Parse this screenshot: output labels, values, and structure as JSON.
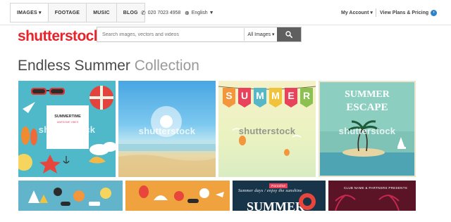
{
  "nav": {
    "tabs": [
      {
        "label": "IMAGES ▾"
      },
      {
        "label": "FOOTAGE"
      },
      {
        "label": "MUSIC"
      },
      {
        "label": "BLOG"
      }
    ],
    "phone": "020 7023 4958",
    "language": "English ▼",
    "account": "My Account ▾",
    "plans": "View Plans & Pricing"
  },
  "brand": {
    "logo": "shutterstock"
  },
  "search": {
    "placeholder": "Search images, vectors and videos",
    "type": "All Images ▾"
  },
  "collection": {
    "title_main": "Endless Summer",
    "title_sub": "Collection"
  },
  "tiles": {
    "watermark": "shutterstock",
    "t1": {
      "card_title": "SUMMERTIME",
      "card_sub": "AWESOME VIBES"
    },
    "t3": {
      "letters": [
        "S",
        "U",
        "M",
        "M",
        "E",
        "R"
      ]
    },
    "t4": {
      "line1": "SUMMER",
      "line2": "ESCAPE"
    },
    "t7": {
      "badge": "Paradise",
      "script": "Summer days / enjoy the sunshine",
      "big": "SUMMER"
    },
    "t8": {
      "caption": "CLUB NAME & PARTNERS PRESENTS"
    }
  },
  "colors": {
    "brand_red": "#e8242b",
    "nav_bg": "#ffffff",
    "search_button": "#5f5f5f",
    "accent_blue": "#2f82c4"
  }
}
